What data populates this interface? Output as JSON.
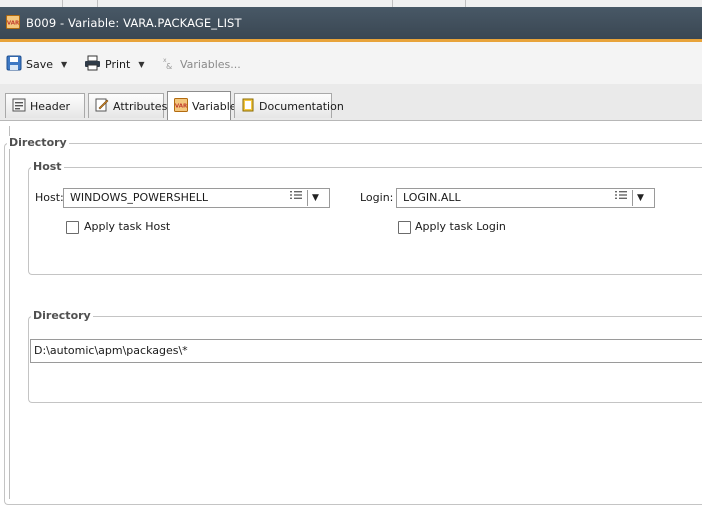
{
  "window": {
    "title": "B009 - Variable: VARA.PACKAGE_LIST"
  },
  "toolbar": {
    "save_label": "Save",
    "print_label": "Print",
    "variables_label": "Variables..."
  },
  "tabs": [
    {
      "label": "Header"
    },
    {
      "label": "Attributes"
    },
    {
      "label": "Variable"
    },
    {
      "label": "Documentation"
    }
  ],
  "directory_section": {
    "legend": "Directory"
  },
  "host_group": {
    "legend": "Host",
    "host_label": "Host:",
    "host_value": "WINDOWS_POWERSHELL",
    "apply_host_label": "Apply task Host",
    "login_label": "Login:",
    "login_value": "LOGIN.ALL",
    "apply_login_label": "Apply task Login"
  },
  "directory_group": {
    "legend": "Directory",
    "path_value": "D:\\automic\\apm\\packages\\*"
  },
  "colors": {
    "titlebar": "#3f4c58",
    "accent": "#e8a33a"
  }
}
